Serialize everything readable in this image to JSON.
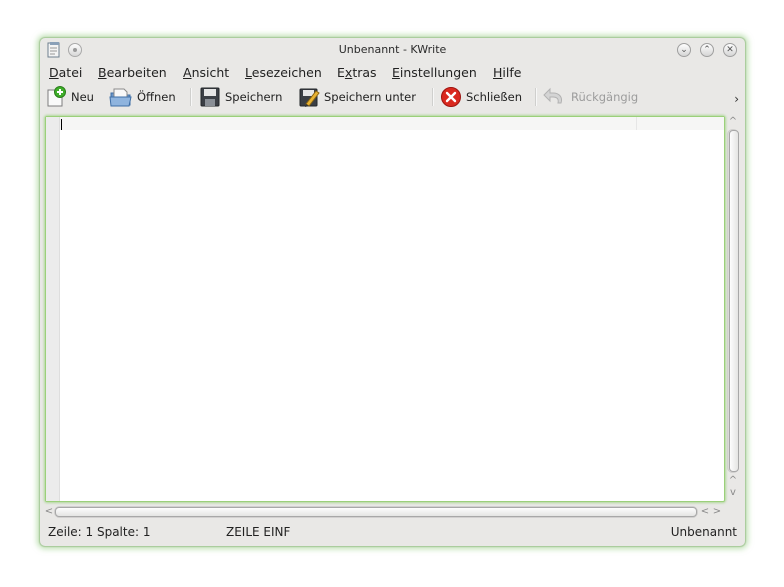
{
  "window": {
    "title": "Unbenannt - KWrite",
    "controls": {
      "minimize": "⌄",
      "maximize": "⌃",
      "close": "✕"
    }
  },
  "menubar": {
    "items": [
      {
        "mnemonic": "D",
        "rest": "atei"
      },
      {
        "mnemonic": "B",
        "rest": "earbeiten"
      },
      {
        "mnemonic": "A",
        "rest": "nsicht"
      },
      {
        "mnemonic": "L",
        "rest": "esezeichen"
      },
      {
        "pre": "E",
        "mnemonic": "x",
        "rest": "tras"
      },
      {
        "mnemonic": "E",
        "rest": "instellungen"
      },
      {
        "mnemonic": "H",
        "rest": "ilfe"
      }
    ]
  },
  "toolbar": {
    "new": {
      "label": "Neu",
      "icon": "new-document-icon"
    },
    "open": {
      "label": "Öffnen",
      "icon": "open-folder-icon"
    },
    "save": {
      "label": "Speichern",
      "icon": "floppy-disk-icon"
    },
    "save_as": {
      "label": "Speichern unter",
      "icon": "save-as-icon"
    },
    "close": {
      "label": "Schließen",
      "icon": "close-icon"
    },
    "undo": {
      "label": "Rückgängig",
      "icon": "undo-icon",
      "enabled": false
    },
    "more": "›"
  },
  "editor": {
    "content": ""
  },
  "statusbar": {
    "position": "Zeile: 1 Spalte: 1",
    "mode": "ZEILE EINF",
    "filename": "Unbenannt"
  },
  "colors": {
    "window_bg": "#e9e8e6",
    "focus_glow": "#9bd07a",
    "close_red": "#d9291f"
  }
}
